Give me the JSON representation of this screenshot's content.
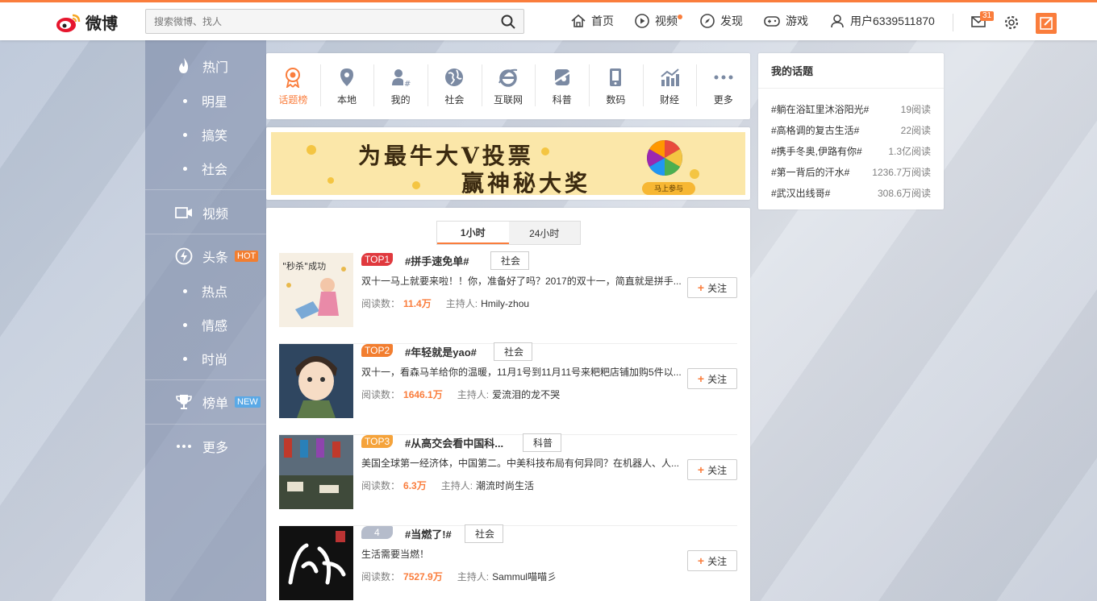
{
  "header": {
    "logo_text": "微博",
    "search_placeholder": "搜索微博、找人",
    "nav": [
      {
        "label": "首页"
      },
      {
        "label": "视频"
      },
      {
        "label": "发现"
      },
      {
        "label": "游戏"
      },
      {
        "label": "用户6339511870"
      }
    ],
    "message_count": "31"
  },
  "sidebar": {
    "items": [
      {
        "label": "热门"
      },
      {
        "label": "明星"
      },
      {
        "label": "搞笑"
      },
      {
        "label": "社会"
      },
      {
        "label": "视频"
      },
      {
        "label": "头条",
        "tag": "HOT"
      },
      {
        "label": "热点"
      },
      {
        "label": "情感"
      },
      {
        "label": "时尚"
      },
      {
        "label": "榜单",
        "tag": "NEW"
      },
      {
        "label": "更多"
      }
    ]
  },
  "categories": [
    {
      "label": "话题榜",
      "icon": "ribbon-icon"
    },
    {
      "label": "本地",
      "icon": "location-icon"
    },
    {
      "label": "我的",
      "icon": "user-hash-icon"
    },
    {
      "label": "社会",
      "icon": "globe-icon"
    },
    {
      "label": "互联网",
      "icon": "ie-icon"
    },
    {
      "label": "科普",
      "icon": "planet-icon"
    },
    {
      "label": "数码",
      "icon": "phone-icon"
    },
    {
      "label": "财经",
      "icon": "chart-icon"
    },
    {
      "label": "更多",
      "icon": "more-icon"
    }
  ],
  "banner": {
    "line1": "为最牛大V投票",
    "line2": "赢神秘大奖",
    "button": "马上参与"
  },
  "tabs": [
    {
      "label": "1小时"
    },
    {
      "label": "24小时"
    }
  ],
  "topics": [
    {
      "rank": "TOP1",
      "rank_color": "#e0393e",
      "title": "#拼手速免单#",
      "category": "社会",
      "desc": "双十一马上就要来啦！！你，准备好了吗？2017的双十一，简直就是拼手...",
      "read_label": "阅读数：",
      "reads": "11.4万",
      "host_label": "主持人:",
      "host": "Hmily-zhou",
      "follow": "关注"
    },
    {
      "rank": "TOP2",
      "rank_color": "#f27e30",
      "title": "#年轻就是yao#",
      "category": "社会",
      "desc": "双十一，看森马羊给你的温暖，11月1号到11月11号来粑粑店铺加购5件以...",
      "read_label": "阅读数：",
      "reads": "1646.1万",
      "host_label": "主持人:",
      "host": "爱流泪的龙不哭",
      "follow": "关注"
    },
    {
      "rank": "TOP3",
      "rank_color": "#f5a33b",
      "title": "#从高交会看中国科...",
      "category": "科普",
      "desc": "美国全球第一经济体，中国第二。中美科技布局有何异同？在机器人、人...",
      "read_label": "阅读数：",
      "reads": "6.3万",
      "host_label": "主持人:",
      "host": "潮流时尚生活",
      "follow": "关注"
    },
    {
      "rank": "4",
      "rank_color": "#b5bccb",
      "title": "#当燃了!#",
      "category": "社会",
      "desc": "生活需要当燃！",
      "read_label": "阅读数：",
      "reads": "7527.9万",
      "host_label": "主持人:",
      "host": "Sammul喵喵彡",
      "follow": "关注"
    }
  ],
  "my_topics": {
    "title": "我的话题",
    "rows": [
      {
        "name": "#躺在浴缸里沐浴阳光#",
        "reads": "19阅读"
      },
      {
        "name": "#高格调的复古生活#",
        "reads": "22阅读"
      },
      {
        "name": "#携手冬奥,伊路有你#",
        "reads": "1.3亿阅读"
      },
      {
        "name": "#第一背后的汗水#",
        "reads": "1236.7万阅读"
      },
      {
        "name": "#武汉出线哥#",
        "reads": "308.6万阅读"
      }
    ]
  },
  "colors": {
    "accent": "#fa7d3c",
    "hot_tag": "#f27e30",
    "new_tag": "#5aa9e6"
  }
}
